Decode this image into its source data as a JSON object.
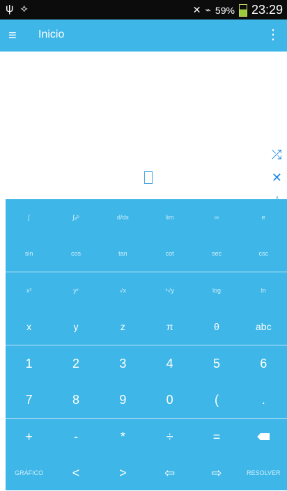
{
  "status": {
    "battery": "59%",
    "time": "23:29"
  },
  "header": {
    "title": "Inicio",
    "menu_icon": "menu-icon",
    "more_icon": "more-vert-icon"
  },
  "workspace": {
    "actions": [
      "shuffle-icon",
      "close-icon",
      "star-icon"
    ]
  },
  "keypad": {
    "row1": [
      "∫",
      "∫ₐᵇ",
      "d/dx",
      "lim",
      "∞",
      "e"
    ],
    "row2": [
      "sin",
      "cos",
      "tan",
      "cot",
      "sec",
      "csc"
    ],
    "row3": [
      "x²",
      "yˣ",
      "√x",
      "ˣ√y",
      "log",
      "ln"
    ],
    "row4": [
      "x",
      "y",
      "z",
      "π",
      "θ",
      "abc"
    ],
    "row5": [
      "1",
      "2",
      "3",
      "4",
      "5",
      "6"
    ],
    "row6": [
      "7",
      "8",
      "9",
      "0",
      "(",
      "."
    ],
    "row7": [
      "+",
      "-",
      "*",
      "÷",
      "=",
      "⌫"
    ],
    "row8": [
      "GRÁFICO",
      "<",
      ">",
      "⇦",
      "⇨",
      "RESOLVER"
    ]
  },
  "colors": {
    "primary": "#3eb6e7",
    "statusbar": "#0c0c0c",
    "workspace": "#ffffff"
  }
}
